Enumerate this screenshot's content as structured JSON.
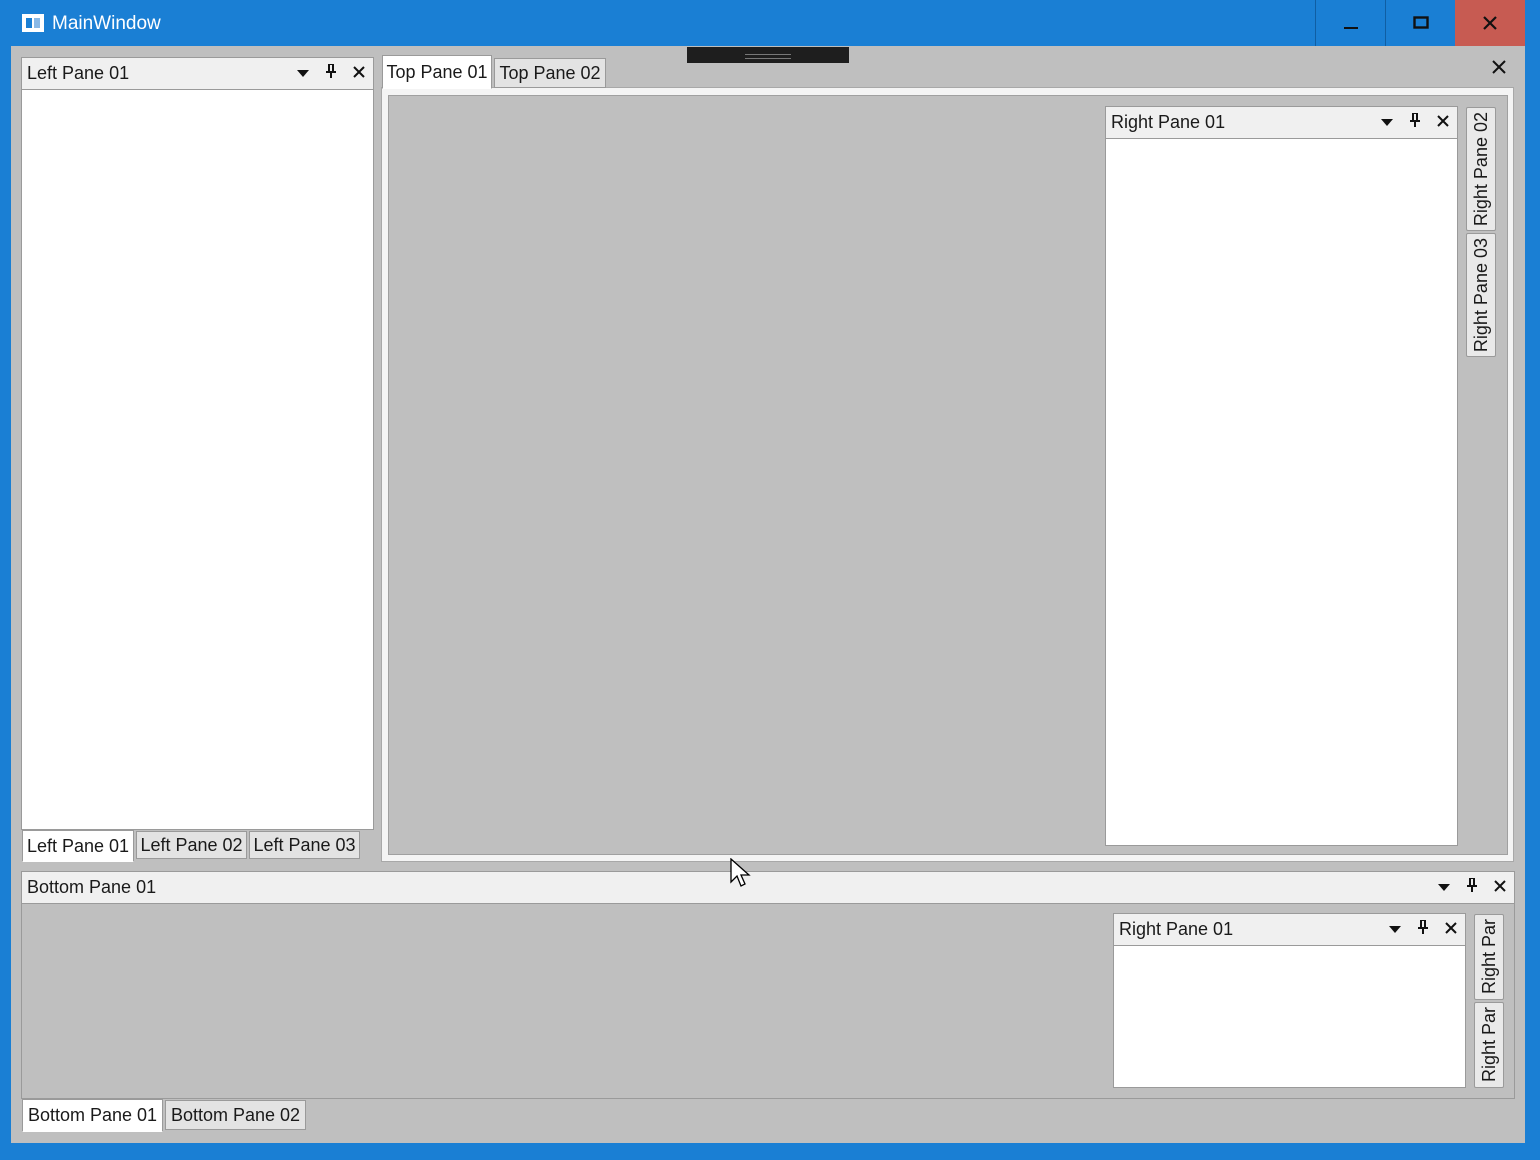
{
  "window": {
    "title": "MainWindow",
    "controls": {
      "minimize": "–",
      "maximize": "□",
      "close": "✕"
    }
  },
  "left_group": {
    "header": "Left Pane 01",
    "tabs": [
      "Left Pane 01",
      "Left Pane 02",
      "Left Pane 03"
    ],
    "active_tab": 0
  },
  "top_group": {
    "tabs": [
      "Top Pane 01",
      "Top Pane 02"
    ],
    "active_tab": 0,
    "right_pane": {
      "header": "Right Pane 01"
    },
    "side_tabs": [
      "Right Pane 02",
      "Right Pane 03"
    ]
  },
  "bottom_group": {
    "header": "Bottom Pane 01",
    "tabs": [
      "Bottom Pane 01",
      "Bottom Pane 02"
    ],
    "active_tab": 0,
    "right_pane": {
      "header": "Right Pane 01"
    },
    "side_tabs": [
      "Right Par",
      "Right Par"
    ]
  },
  "icons": {
    "dropdown": "dropdown-arrow-icon",
    "pin": "pin-icon",
    "close": "close-icon"
  },
  "colors": {
    "titlebar": "#1a7fd4",
    "close_button": "#c75b52",
    "client_bg": "#bfbfbf"
  }
}
